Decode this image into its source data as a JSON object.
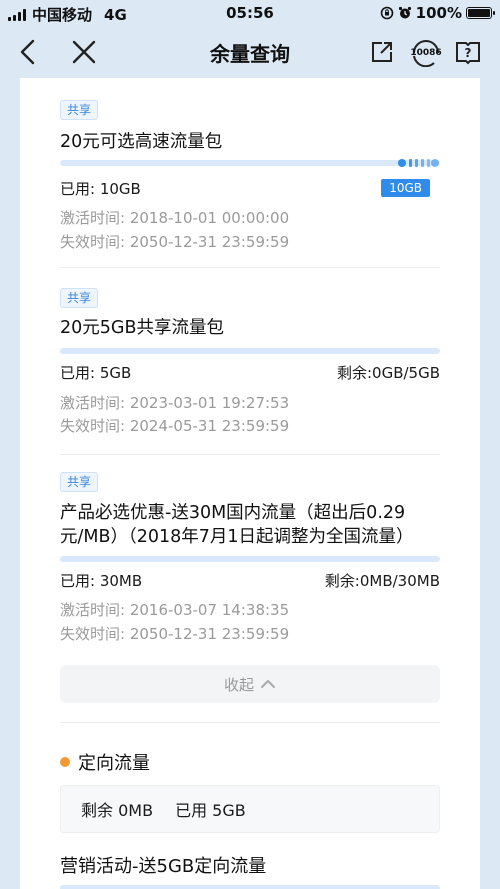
{
  "status_bar": {
    "carrier": "中国移动",
    "network": "4G",
    "time": "05:56",
    "battery": "100%"
  },
  "nav": {
    "title": "余量查询",
    "service_number": "10086"
  },
  "packages": [
    {
      "tag": "共享",
      "name": "20元可选高速流量包",
      "used": "已用: 10GB",
      "badge": "10GB",
      "remain": "",
      "activated": "激活时间: 2018-10-01 00:00:00",
      "expires": "失效时间: 2050-12-31 23:59:59",
      "used_fraction": 0.91
    },
    {
      "tag": "共享",
      "name": "20元5GB共享流量包",
      "used": "已用: 5GB",
      "badge": "",
      "remain": "剩余:0GB/5GB",
      "activated": "激活时间: 2023-03-01 19:27:53",
      "expires": "失效时间: 2024-05-31 23:59:59",
      "used_fraction": 1.0
    },
    {
      "tag": "共享",
      "name": "产品必选优惠-送30M国内流量（超出后0.29元/MB）（2018年7月1日起调整为全国流量）",
      "used": "已用: 30MB",
      "badge": "",
      "remain": "剩余:0MB/30MB",
      "activated": "激活时间: 2016-03-07 14:38:35",
      "expires": "失效时间: 2050-12-31 23:59:59",
      "used_fraction": 1.0
    }
  ],
  "collapse": {
    "label": "收起"
  },
  "directed": {
    "title": "定向流量",
    "remain": "剩余 0MB",
    "used": "已用 5GB",
    "next_item_title": "营销活动-送5GB定向流量"
  },
  "colors": {
    "accent": "#2f8ceb",
    "bar_track": "#d9e9fb",
    "dot": "#f39a36",
    "header_bg": "#dce9f5"
  }
}
